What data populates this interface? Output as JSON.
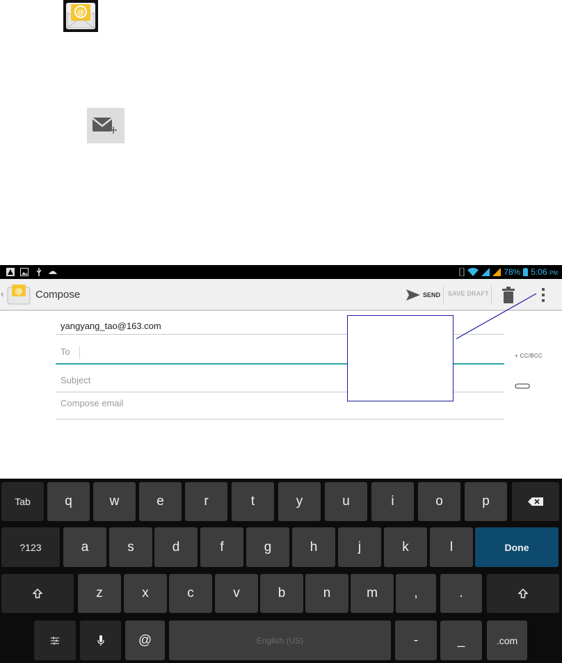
{
  "compose": {
    "title": "Compose",
    "send_label": "SEND",
    "save_draft_label": "SAVE DRAFT",
    "from_address": "yangyang_tao@163.com",
    "to_placeholder": "To",
    "subject_placeholder": "Subject",
    "body_placeholder": "Compose email",
    "cc_bcc_label": "+ CC/BCC"
  },
  "status_bar": {
    "battery": "78%",
    "time": "5:06",
    "ampm": "PM"
  },
  "keyboard": {
    "row1": [
      "Tab",
      "q",
      "w",
      "e",
      "r",
      "t",
      "y",
      "u",
      "i",
      "o",
      "p"
    ],
    "row2": [
      "?123",
      "a",
      "s",
      "d",
      "f",
      "g",
      "h",
      "j",
      "k",
      "l",
      "Done"
    ],
    "row3": [
      "z",
      "x",
      "c",
      "v",
      "b",
      "n",
      "m",
      ",",
      "."
    ],
    "row4": [
      "@",
      "English (US)",
      "-",
      "_",
      ".com"
    ]
  },
  "icons": {
    "app": "email-at-envelope-icon",
    "compose": "new-mail-plus-icon",
    "send": "send-arrow-icon",
    "delete": "trash-icon",
    "overflow": "more-vert-icon",
    "attach": "paperclip-icon",
    "backspace": "backspace-icon",
    "shift": "shift-arrow-icon",
    "mic": "microphone-icon",
    "settings": "keyboard-settings-icon"
  },
  "colors": {
    "status_bar_icons": "#33b5e5",
    "focus_line": "#2aa4a4",
    "done_key": "#0e4a6e",
    "callout": "#1a1aa0"
  }
}
